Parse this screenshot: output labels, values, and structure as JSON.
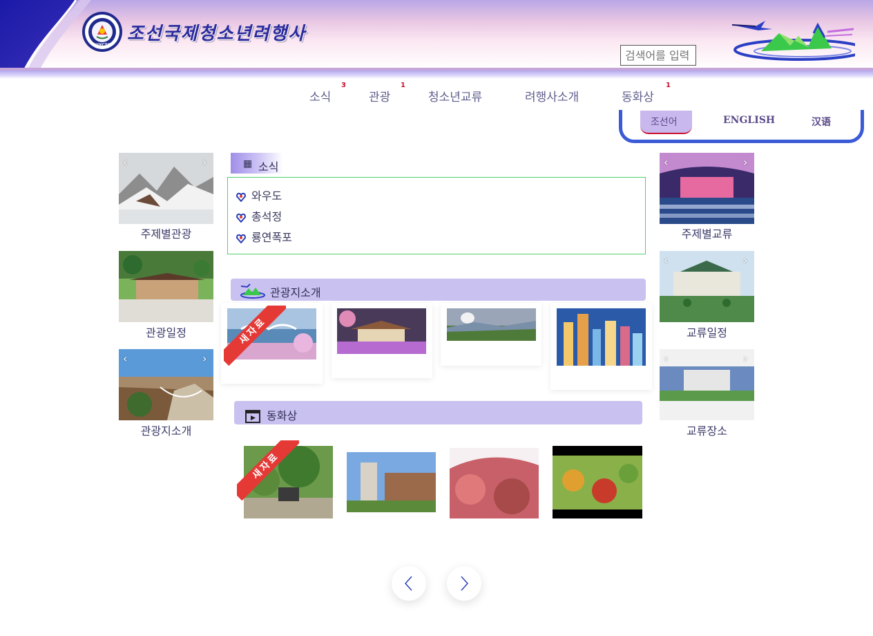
{
  "header": {
    "site_title": "조선국제청소년려행사",
    "emblem_text": "KIYCTC",
    "search_placeholder": "검색어를 입력"
  },
  "nav": [
    {
      "label": "소식",
      "badge": "3"
    },
    {
      "label": "관광",
      "badge": "1"
    },
    {
      "label": "청소년교류",
      "badge": ""
    },
    {
      "label": "려행사소개",
      "badge": ""
    },
    {
      "label": "동화상",
      "badge": "1"
    }
  ],
  "languages": [
    "조선어",
    "ENGLISH",
    "汉语"
  ],
  "left_tiles": [
    "주제별관광",
    "관광일정",
    "관광지소개"
  ],
  "right_tiles": [
    "주제별교류",
    "교류일정",
    "교류장소"
  ],
  "news": {
    "title": "소식",
    "items": [
      "와우도",
      "총석정",
      "룡연폭포"
    ]
  },
  "tour": {
    "title": "관광지소개",
    "ribbon": "새자료"
  },
  "video": {
    "title": "동화상",
    "ribbon": "새자료"
  },
  "colors": {
    "accent": "#3b5bd6",
    "section_bg": "#c9c1f0",
    "news_border": "#4ed16b",
    "ribbon": "#e53935",
    "badge": "#c8102e"
  }
}
